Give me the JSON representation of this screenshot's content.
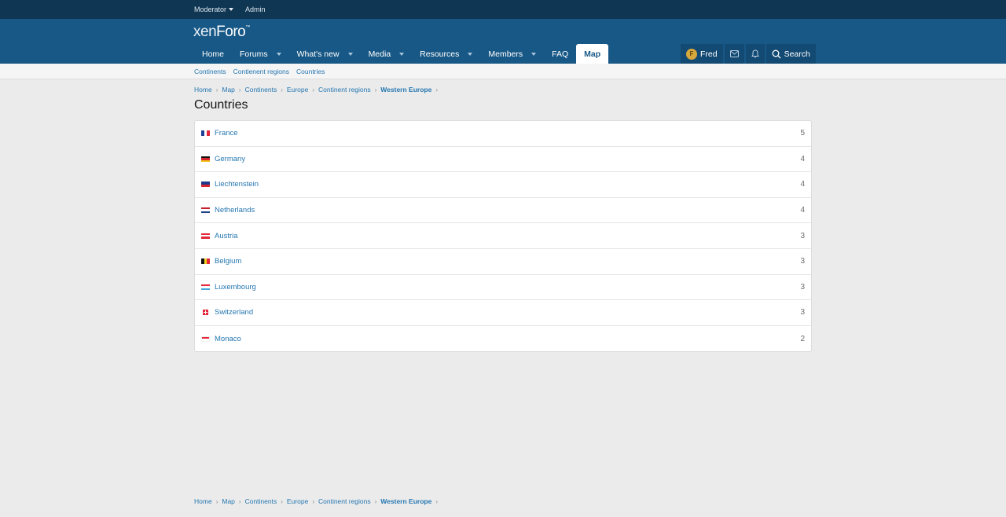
{
  "staffbar": {
    "moderator": "Moderator",
    "admin": "Admin"
  },
  "logo": {
    "part1": "xen",
    "part2": "Foro"
  },
  "nav": [
    {
      "label": "Home",
      "dropdown": false
    },
    {
      "label": "Forums",
      "dropdown": true
    },
    {
      "label": "What's new",
      "dropdown": true
    },
    {
      "label": "Media",
      "dropdown": true
    },
    {
      "label": "Resources",
      "dropdown": true
    },
    {
      "label": "Members",
      "dropdown": true
    },
    {
      "label": "FAQ",
      "dropdown": false
    },
    {
      "label": "Map",
      "dropdown": false,
      "active": true
    }
  ],
  "user": {
    "avatar_letter": "F",
    "name": "Fred",
    "search_label": "Search"
  },
  "subnav": [
    "Continents",
    "Contienent regions",
    "Countries"
  ],
  "breadcrumb": [
    "Home",
    "Map",
    "Continents",
    "Europe",
    "Continent regions",
    "Western Europe"
  ],
  "page_title": "Countries",
  "countries": [
    {
      "name": "France",
      "count": "5",
      "flag": "france"
    },
    {
      "name": "Germany",
      "count": "4",
      "flag": "germany"
    },
    {
      "name": "Liechtenstein",
      "count": "4",
      "flag": "liechtenstein"
    },
    {
      "name": "Netherlands",
      "count": "4",
      "flag": "netherlands"
    },
    {
      "name": "Austria",
      "count": "3",
      "flag": "austria"
    },
    {
      "name": "Belgium",
      "count": "3",
      "flag": "belgium"
    },
    {
      "name": "Luxembourg",
      "count": "3",
      "flag": "luxembourg"
    },
    {
      "name": "Switzerland",
      "count": "3",
      "flag": "switzerland"
    },
    {
      "name": "Monaco",
      "count": "2",
      "flag": "monaco"
    }
  ],
  "colors": {
    "header": "#185886",
    "staffbar": "#0f3652",
    "link": "#2577b1",
    "background": "#ebebeb"
  }
}
